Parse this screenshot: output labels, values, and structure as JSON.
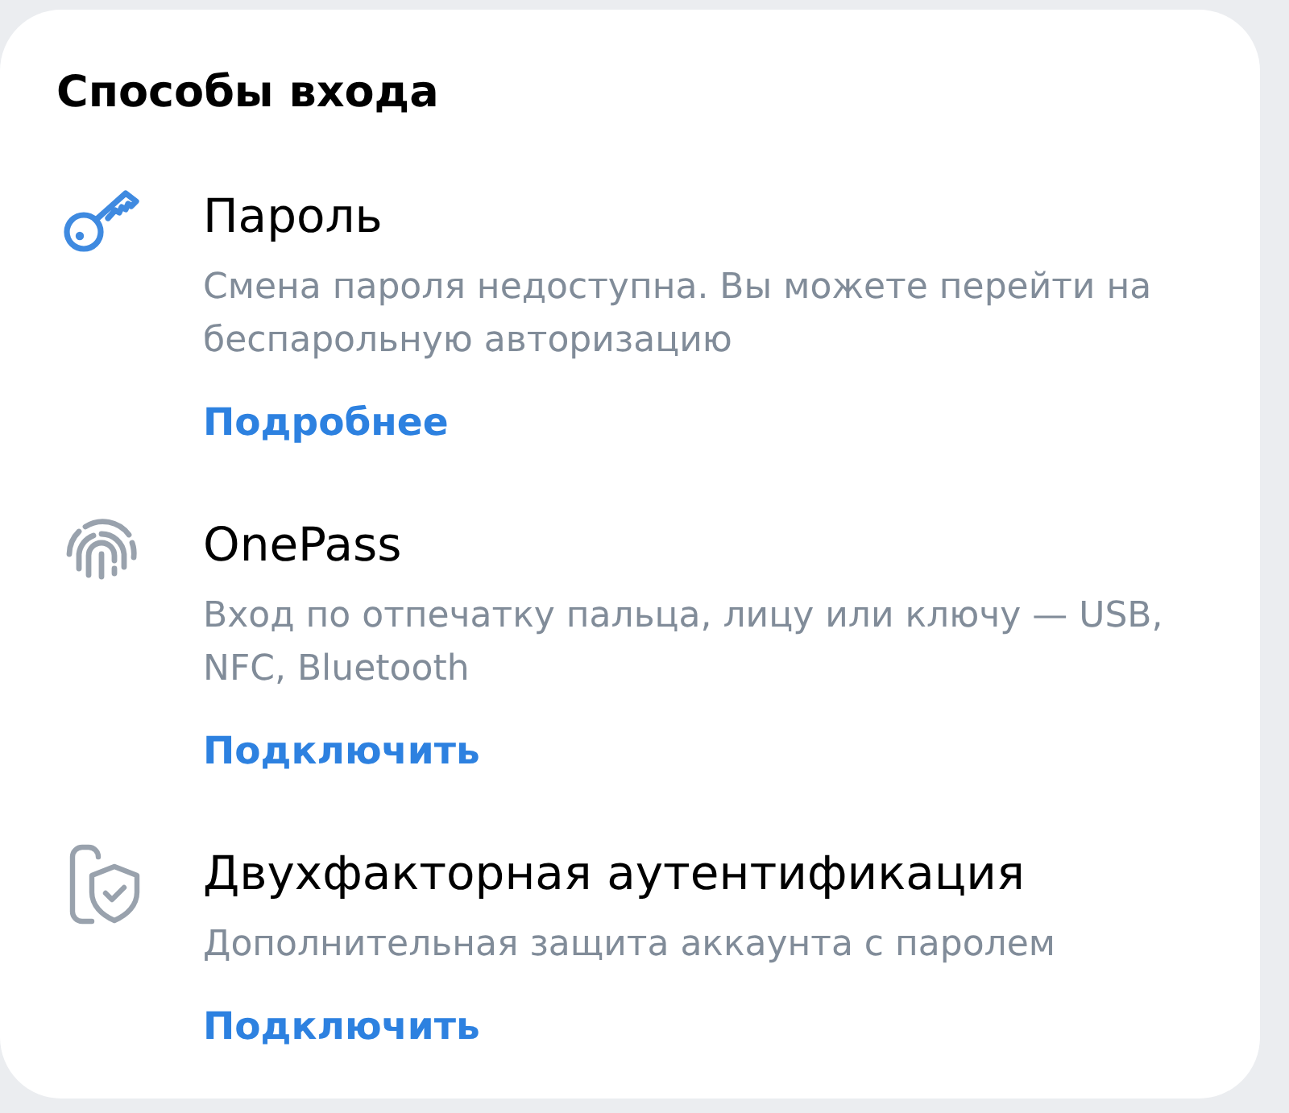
{
  "title": "Способы входа",
  "methods": [
    {
      "kind": "password",
      "active": true,
      "title": "Пароль",
      "description": "Смена пароля недоступна. Вы можете перейти на беспарольную авторизацию",
      "action": "Подробнее"
    },
    {
      "kind": "onepass",
      "active": false,
      "title": "OnePass",
      "description": "Вход по отпечатку пальца, лицу или ключу — USB, NFC, Bluetooth",
      "action": "Подключить"
    },
    {
      "kind": "two_factor",
      "active": false,
      "title": "Двухфакторная аутентификация",
      "description": "Дополнительная защита аккаунта с паролем",
      "action": "Подключить"
    }
  ]
}
